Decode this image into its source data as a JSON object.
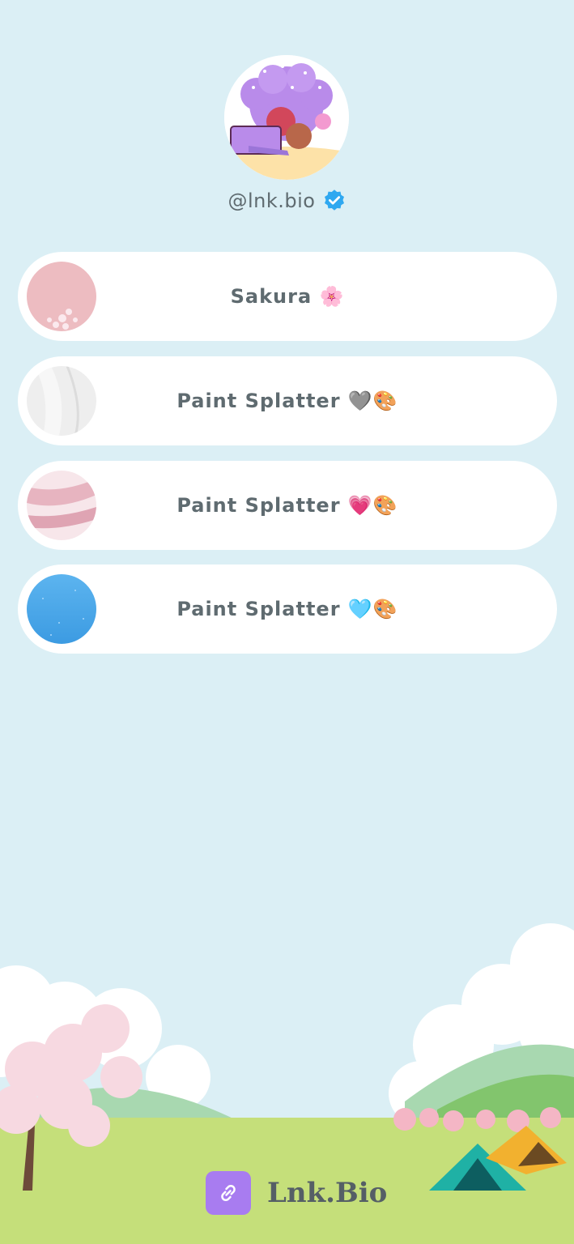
{
  "profile": {
    "handle": "@lnk.bio"
  },
  "links": [
    {
      "label": "Sakura 🌸"
    },
    {
      "label": "Paint Splatter 🩶🎨"
    },
    {
      "label": "Paint Splatter 💗🎨"
    },
    {
      "label": "Paint Splatter 🩵🎨"
    }
  ],
  "footer": {
    "brand": "Lnk.Bio"
  },
  "colors": {
    "background": "#dbeff5",
    "card": "#ffffff",
    "text": "#5f6b70",
    "verified": "#2fa8f0",
    "brand_icon": "#a87cf0",
    "grass": "#c5df7a"
  }
}
